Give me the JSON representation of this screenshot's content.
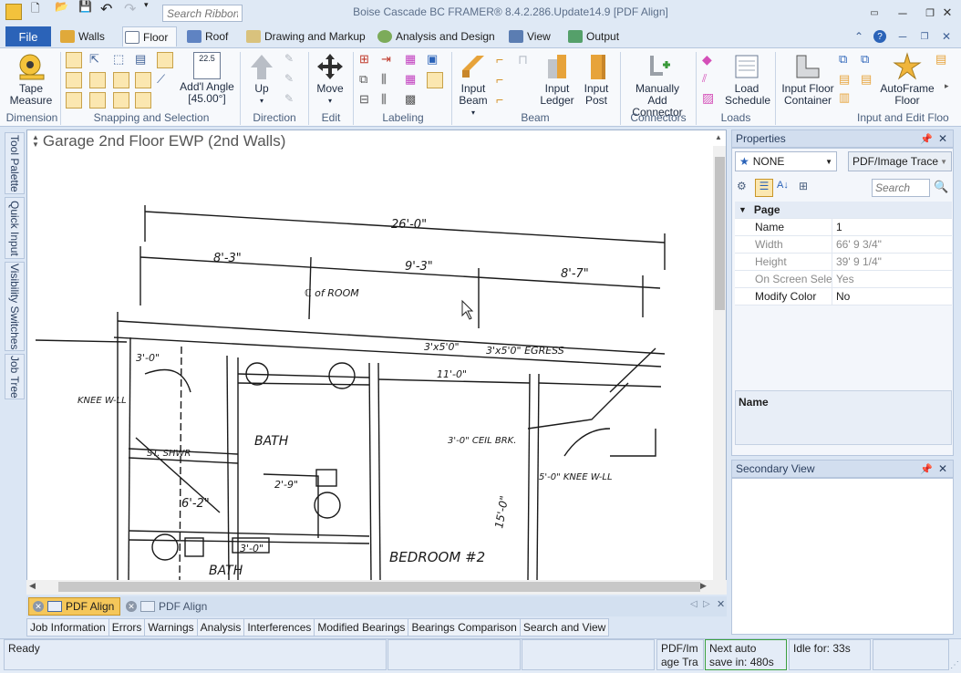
{
  "app": {
    "title": "Boise Cascade BC FRAMER® 8.4.2.286.Update14.9 [PDF Align]",
    "ribbon_search_placeholder": "Search Ribbon"
  },
  "tabs": [
    "File",
    "Walls",
    "Floor",
    "Roof",
    "Drawing and Markup",
    "Analysis and Design",
    "View",
    "Output"
  ],
  "ribbon": {
    "buttons": {
      "tape_measure": "Tape Measure",
      "addl_angle": "Add'l Angle",
      "addl_angle_value": "[45.00°]",
      "addl_angle_icon_text": "22.5",
      "up": "Up",
      "move": "Move",
      "input_beam": "Input Beam",
      "input_ledger": "Input Ledger",
      "input_post": "Input Post",
      "manually_add_connector": "Manually Add Connector",
      "load_schedule": "Load Schedule",
      "input_floor_container": "Input Floor Container",
      "autoframe_floor": "AutoFrame Floor"
    },
    "groups": [
      "Dimension",
      "Snapping and Selection",
      "Direction",
      "Edit",
      "Labeling",
      "Beam",
      "Connectors",
      "Loads",
      "Input and Edit Floo"
    ]
  },
  "left_dock": [
    "Tool Palette",
    "Quick Input",
    "Visibility Switches",
    "Job Tree"
  ],
  "canvas": {
    "plan_title": "Garage 2nd Floor EWP (2nd Walls)",
    "sketch_labels": {
      "overall": "26'-0\"",
      "dim1": "8'-3\"",
      "dim2": "9'-3\"",
      "dim3": "8'-7\"",
      "room": "ℂ of ROOM",
      "dim_a": "3'-0\"",
      "dim_b": "3'x5'0\"",
      "dim_c": "3'x5'0\" EGRESS",
      "bath": "BATH",
      "bath2": "BATH",
      "bedroom": "BEDROOM #2",
      "ceil": "3'-0\" CEIL BRK.",
      "knee": "5'-0\" KNEE W-LL",
      "knee_left": "KNEE W-LL",
      "shwr": "ST. SHWR",
      "d15": "15'-0\"",
      "d62": "6'-2\"",
      "d29": "2'-9\"",
      "d11": "11'-0\"",
      "d30": "3'-0\""
    }
  },
  "document_tabs": [
    "PDF Align",
    "PDF Align"
  ],
  "bottom_tabs": [
    "Job Information",
    "Errors",
    "Warnings",
    "Analysis",
    "Interferences",
    "Modified Bearings",
    "Bearings Comparison",
    "Search and View"
  ],
  "properties": {
    "header": "Properties",
    "selector_value": "NONE",
    "type_value": "PDF/Image Trace",
    "search_placeholder": "Search",
    "category": "Page",
    "rows": [
      {
        "key": "Name",
        "value": "1"
      },
      {
        "key": "Width",
        "value": "66' 9 3/4\""
      },
      {
        "key": "Height",
        "value": "39' 9 1/4\""
      },
      {
        "key": "On Screen Select",
        "value": "Yes"
      },
      {
        "key": "Modify Color",
        "value": "No"
      }
    ],
    "description_title": "Name"
  },
  "secondary_view": {
    "header": "Secondary View"
  },
  "status": {
    "ready": "Ready",
    "mode": "PDF/Image Trace",
    "autosave": "Next auto save in: 480s",
    "idle": "Idle for: 33s"
  },
  "colors": {
    "accent": "#2b63b8",
    "ribbon_bg": "#f7f9fc",
    "frame_bg": "#dbe6f4"
  }
}
